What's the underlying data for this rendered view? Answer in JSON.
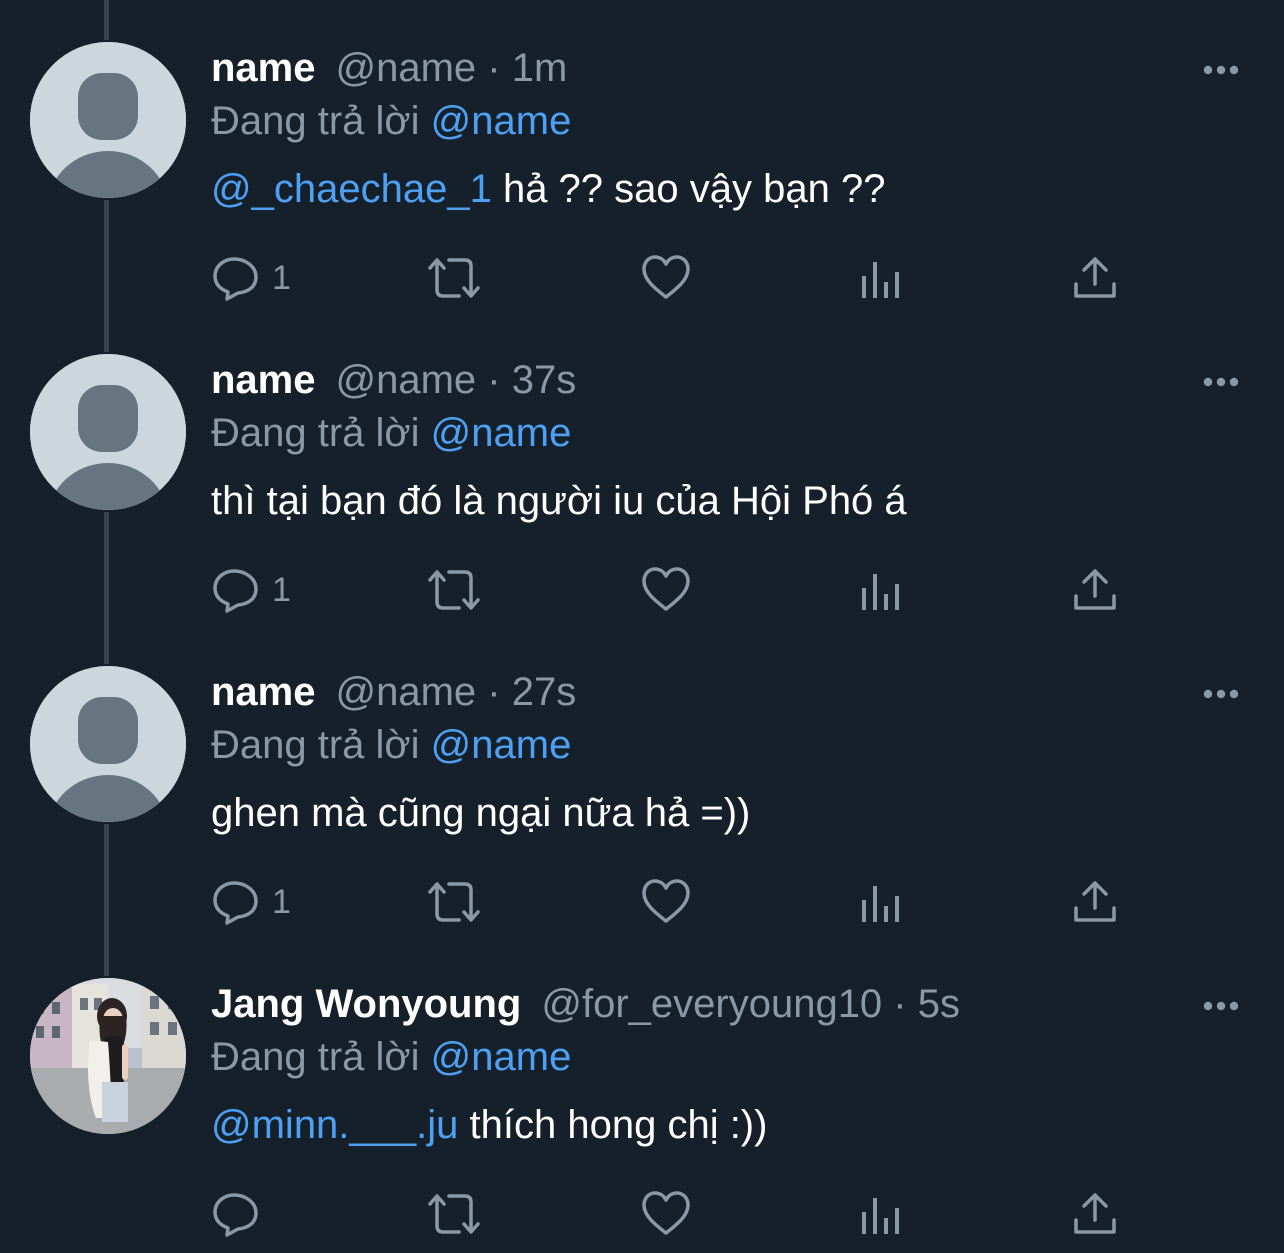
{
  "tweets": [
    {
      "display_name": "name",
      "handle_meta": "@name · 1m",
      "reply_prefix": "Đang trả lời",
      "reply_to": "@name",
      "mention": "@_chaechae_1",
      "body": " hả ?? sao vậy bạn ??",
      "reply_count": "1",
      "avatar": "default-avatar"
    },
    {
      "display_name": "name",
      "handle_meta": "@name · 37s",
      "reply_prefix": "Đang trả lời",
      "reply_to": "@name",
      "mention": "",
      "body": "thì tại bạn đó là người iu của Hội Phó á",
      "reply_count": "1",
      "avatar": "default-avatar"
    },
    {
      "display_name": "name",
      "handle_meta": "@name · 27s",
      "reply_prefix": "Đang trả lời",
      "reply_to": "@name",
      "mention": "",
      "body": "ghen mà cũng ngại nữa hả =))",
      "reply_count": "1",
      "avatar": "default-avatar"
    },
    {
      "display_name": "Jang Wonyoung",
      "handle_meta": "@for_everyoung10 · 5s",
      "reply_prefix": "Đang trả lời",
      "reply_to": "@name",
      "mention": "@minn.___.ju",
      "body": " thích hong chị :))",
      "reply_count": "",
      "avatar": "photo-avatar"
    }
  ],
  "icons": {
    "reply": "reply-icon",
    "retweet": "retweet-icon",
    "like": "heart-icon",
    "views": "views-icon",
    "share": "share-icon",
    "more": "more-icon"
  },
  "colors": {
    "background": "#15202b",
    "text": "#ffffff",
    "secondary": "#8b98a5",
    "accent": "#4ea1f2",
    "thread_line": "#38444d"
  }
}
